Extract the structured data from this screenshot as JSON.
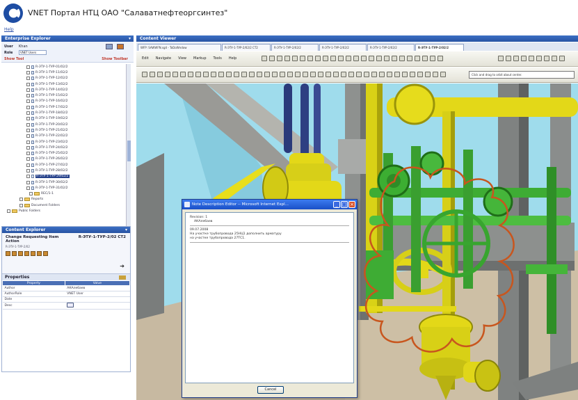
{
  "app": {
    "title": "VNET Портал НТЦ ОАО \"Салаватнефтеоргсинтез\"",
    "menu_help": "Help"
  },
  "enterprise_explorer": {
    "header": "Enterprise Explorer",
    "user_label": "User",
    "user_value": "Khan",
    "role_label": "Role",
    "role_value": "VNET Users",
    "show_tool_label": "Show Tool",
    "show_toolbar_label": "Show Toolbar",
    "tree_items": [
      "R-ЭТУ-1-ТУР-01/02/2",
      "R-ЭТУ-1-ТУР-11/02/2",
      "R-ЭТУ-1-ТУР-12/02/2",
      "R-ЭТУ-1-ТУР-13/02/2",
      "R-ЭТУ-1-ТУР-14/02/2",
      "R-ЭТУ-1-ТУР-15/02/2",
      "R-ЭТУ-1-ТУР-16/02/2",
      "R-ЭТУ-1-ТУР-17/02/2",
      "R-ЭТУ-1-ТУР-18/02/2",
      "R-ЭТУ-1-ТУР-19/02/2",
      "R-ЭТУ-1-ТУР-20/02/2",
      "R-ЭТУ-1-ТУР-21/02/2",
      "R-ЭТУ-1-ТУР-22/02/2",
      "R-ЭТУ-1-ТУР-23/02/2",
      "R-ЭТУ-1-ТУР-24/02/2",
      "R-ЭТУ-1-ТУР-25/02/2",
      "R-ЭТУ-1-ТУР-26/02/2",
      "R-ЭТУ-1-ТУР-27/02/2",
      "R-ЭТУ-1-ТУР-28/02/2",
      "R-ЭТУ-1-ТУР-29/02/2",
      "R-ЭТУ-1-ТУР-30/02/2",
      "R-ЭТУ-1-ТУР-31/02/2"
    ],
    "tree_selected_index": 19,
    "tree_folders": [
      "REC/1-1",
      "Reports",
      "Document Folders",
      "Public Folders"
    ]
  },
  "content_explorer": {
    "header": "Content Explorer",
    "title": "Change Requesting Item Action",
    "doc_id": "R-ЭТУ-1-ТУР-2/02 СТ2",
    "subtitle": "R-ЭТУ-1-ТУР-2/02",
    "properties_label": "Properties",
    "columns": [
      "Property",
      "Value"
    ],
    "rows": [
      {
        "name": "Author",
        "value": "АКАлебаев"
      },
      {
        "name": "AuthorRole",
        "value": "VNET User"
      },
      {
        "name": "Date",
        "value": ""
      },
      {
        "name": "Desc",
        "value": ""
      }
    ]
  },
  "content_viewer": {
    "header": "Content Viewer",
    "tabs": [
      "WFP: SAWWFN.sg4 - ToDoWndow",
      "R-ЭТУ-1-ТУР-2/02/2 СТ2",
      "R-ЭТУ-1-ТУР-2/02/2",
      "R-ЭТУ-1-ТУР-2/02/2",
      "R-ЭТУ-1-ТУР-2/02/2",
      "R-ЭТУ-1-ТУР-2/02/2"
    ],
    "menu": [
      "Edit",
      "Navigate",
      "View",
      "Markup",
      "Tools",
      "Help"
    ],
    "hint": "Click and drag to orbit about center."
  },
  "dialog": {
    "title": "Note Description Editor -- Microsoft Internet Expl...",
    "revision": "Revision: 1",
    "author": "АКАлебаев",
    "date": "09.07.2008",
    "text_1": "На участке трубопровода 25НЦ1 дополнить арматуру",
    "text_2": "на участке трубопровода 27ТС1.",
    "cancel_label": "Cancel"
  },
  "colors": {
    "header_blue": "#2f5fb8",
    "pipe_yellow": "#e3d818",
    "pipe_green": "#3eac34",
    "steel_gray": "#8f9290",
    "floor": "#c7b9a1",
    "markup_cloud": "#c8561e"
  }
}
